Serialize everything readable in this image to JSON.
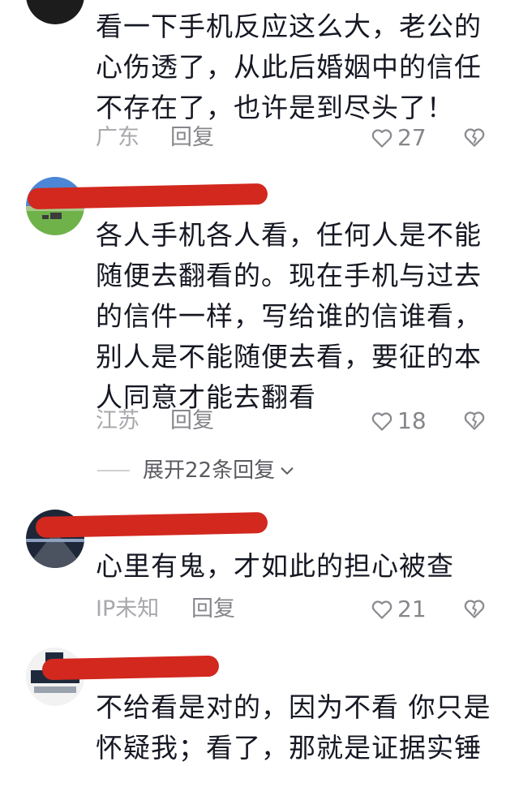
{
  "comments": [
    {
      "text": "看一下手机反应这么大，老公的心伤透了，从此后婚姻中的信任不存在了，也许是到尽头了！",
      "location": "广东",
      "reply_label": "回复",
      "likes": "27"
    },
    {
      "text": "各人手机各人看，任何人是不能随便去翻看的。现在手机与过去的信件一样，写给谁的信谁看，别人是不能随便去看，要征的本人同意才能去翻看",
      "location": "江苏",
      "reply_label": "回复",
      "likes": "18"
    },
    {
      "text": "心里有鬼，才如此的担心被查",
      "location": "IP未知",
      "reply_label": "回复",
      "likes": "21"
    },
    {
      "text": "不给看是对的，因为不看 你只是怀疑我；看了，那就是证据实锤"
    }
  ],
  "expand_replies": {
    "label": "展开22条回复"
  },
  "colors": {
    "redaction": "#d2281e",
    "meta_text": "#a8a8ad",
    "body_text": "#161823"
  },
  "icons": {
    "like": "heart-outline-icon",
    "dislike": "broken-heart-icon",
    "expand": "chevron-down-icon"
  }
}
